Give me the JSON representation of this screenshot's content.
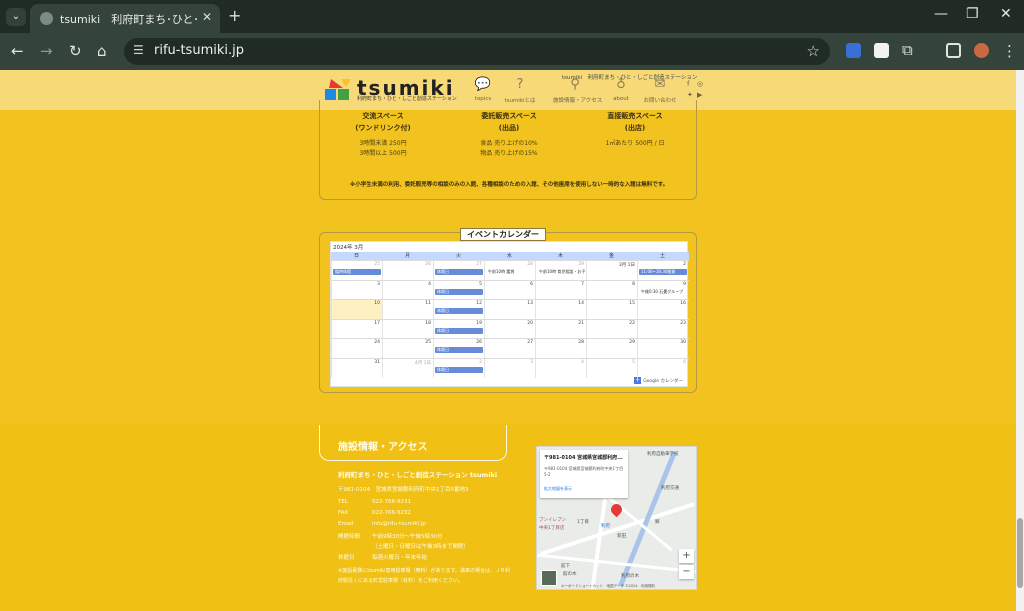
{
  "browser": {
    "tab_title": "tsumiki　利府町まち･ひと･しごと創",
    "url": "rifu-tsumiki.jp"
  },
  "header": {
    "logo_text": "tsumiki",
    "logo_sub": "利府町まち・ひと・しごと創造ステーション",
    "tagline": "tsumiki　利府町まち・ひと・しごと創造ステーション",
    "nav": [
      {
        "icon": "speech-bubble-icon",
        "label": "topics"
      },
      {
        "icon": "question-icon",
        "label": "tsumikiとは"
      },
      {
        "icon": "map-marker-icon",
        "label": "施設情報・アクセス"
      },
      {
        "icon": "lightbulb-icon",
        "label": "about"
      },
      {
        "icon": "mail-icon",
        "label": "お問い合わせ"
      }
    ]
  },
  "pricing": {
    "columns": [
      {
        "title1": "交流スペース",
        "title2": "(ワンドリンク付)",
        "lines": [
          "3時間未満 250円",
          "3時間以上 500円"
        ]
      },
      {
        "title1": "委託販売スペース",
        "title2": "(出品)",
        "lines": [
          "食品 売り上げの10%",
          "物品 売り上げの15%"
        ]
      },
      {
        "title1": "直接販売スペース",
        "title2": "(出店)",
        "lines": [
          "1㎡あたり 500円 / 日"
        ]
      }
    ],
    "note": "※小学生未満の利用、委託販売等の相談のみの入館、各種相談のための入館、その他座席を使用しない一時的な入館は無料です。"
  },
  "calendar": {
    "heading": "イベントカレンダー",
    "month": "2024年 3月",
    "weekdays": [
      "日",
      "月",
      "火",
      "水",
      "木",
      "金",
      "土"
    ],
    "weeks": [
      [
        {
          "d": "25",
          "o": true,
          "e": "臨時休館",
          "b": true
        },
        {
          "d": "26",
          "o": true
        },
        {
          "d": "27",
          "o": true,
          "e": "休館日",
          "b": true
        },
        {
          "d": "28",
          "o": true,
          "e": "午前10時 鑑賞"
        },
        {
          "d": "29",
          "o": true,
          "e": "午前10時 育児相談・お子"
        },
        {
          "d": "3月 1日"
        },
        {
          "d": "2",
          "e": "11:00~16:30雑貨"
        }
      ],
      [
        {
          "d": "3"
        },
        {
          "d": "4"
        },
        {
          "d": "5",
          "e": "休館日",
          "b": true
        },
        {
          "d": "6"
        },
        {
          "d": "7"
        },
        {
          "d": "8"
        },
        {
          "d": "9",
          "e": "午後0:30 石畳グループ"
        }
      ],
      [
        {
          "d": "10",
          "t": true
        },
        {
          "d": "11"
        },
        {
          "d": "12",
          "e": "休館日",
          "b": true
        },
        {
          "d": "13"
        },
        {
          "d": "14"
        },
        {
          "d": "15"
        },
        {
          "d": "16"
        }
      ],
      [
        {
          "d": "17"
        },
        {
          "d": "18"
        },
        {
          "d": "19",
          "e": "休館日",
          "b": true
        },
        {
          "d": "20"
        },
        {
          "d": "21"
        },
        {
          "d": "22"
        },
        {
          "d": "23"
        }
      ],
      [
        {
          "d": "24"
        },
        {
          "d": "25"
        },
        {
          "d": "26",
          "e": "休館日",
          "b": true
        },
        {
          "d": "27"
        },
        {
          "d": "28"
        },
        {
          "d": "29"
        },
        {
          "d": "30"
        }
      ],
      [
        {
          "d": "31"
        },
        {
          "d": "4月 1日",
          "o": true
        },
        {
          "d": "2",
          "o": true,
          "e": "休館日",
          "b": true
        },
        {
          "d": "3",
          "o": true
        },
        {
          "d": "4",
          "o": true
        },
        {
          "d": "5",
          "o": true
        },
        {
          "d": "6",
          "o": true
        }
      ]
    ],
    "footer": "Google カレンダー"
  },
  "facility": {
    "heading": "施設情報・アクセス",
    "name": "利府町まち・ひと・しごと創造ステーション tsumiki",
    "address": "〒981-0104　宮城県宮城郡利府町中央1丁目5番地3",
    "rows": [
      {
        "k": "TEL",
        "v": "022-766-9231"
      },
      {
        "k": "FAX",
        "v": "022-766-9232"
      },
      {
        "k": "Email",
        "v": "info@rifu-tsumiki.jp"
      },
      {
        "k": "開館時間",
        "v": "午前9時30分～午後5時30分"
      },
      {
        "k": "",
        "v": "（土曜日・日曜日は午後3時まで開館）"
      },
      {
        "k": "休館日",
        "v": "毎週火曜日・年末年始"
      }
    ],
    "note": "※施設裏側にtsumiki専用駐車場（無料）があります。満車の場合は、ＪＲ利府駅近くにある町営駐車場（有料）をご利用ください。"
  },
  "map": {
    "card_title": "〒981-0104 宮城県宮城郡利府...",
    "card_addr": "〒981-0104 宮城県宮城郡利府町中央1丁目5-2",
    "card_link": "拡大地図を表示",
    "labels": [
      "利府自動車学校",
      "利府交通",
      "1丁目",
      "利府",
      "ブンイレブン",
      "中央1丁目店",
      "新田",
      "郷",
      "館下",
      "利府の木",
      "館の木"
    ],
    "attribution": "キーボードショートカット　地図データ ©2024　利用規約"
  }
}
